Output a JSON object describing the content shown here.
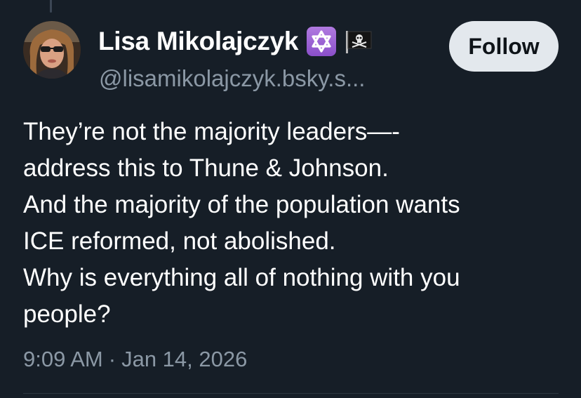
{
  "post": {
    "author": {
      "display_name": "Lisa Mikolajczyk",
      "handle": "@lisamikolajczyk.bsky.s...",
      "name_emojis": [
        "star-of-david-icon",
        "pirate-flag-icon"
      ]
    },
    "follow_label": "Follow",
    "text_lines": [
      "They’re not the majority leaders—-",
      "address this to Thune & Johnson.",
      "And the majority of the population wants",
      "ICE reformed, not abolished.",
      "Why is everything all of nothing with you",
      "people?"
    ],
    "time": "9:09 AM",
    "separator": "·",
    "date": "Jan 14, 2026"
  },
  "theme": {
    "background": "#161e27",
    "text_primary": "#ffffff",
    "text_secondary": "#8b98a5",
    "button_bg": "#e3e8ed",
    "button_text": "#0f1419",
    "emoji_purple": "#9b5fd6"
  }
}
